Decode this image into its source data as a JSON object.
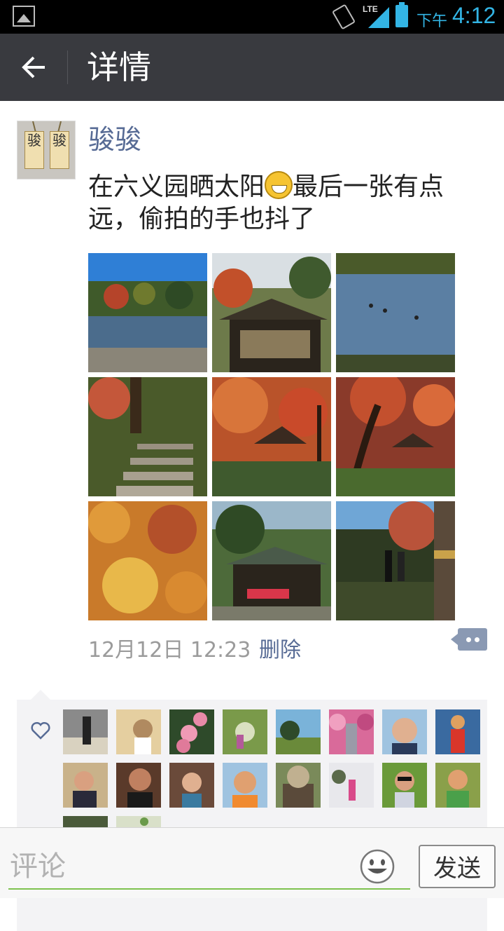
{
  "statusbar": {
    "network": "LTE",
    "ampm": "下午",
    "time": "4:12",
    "icons": [
      "gallery-icon",
      "vibrate-icon",
      "signal-icon",
      "battery-icon"
    ]
  },
  "actionbar": {
    "back_icon": "arrow-left-icon",
    "title": "详情"
  },
  "post": {
    "author": "骏骏",
    "avatar_text": [
      "骏",
      "骏"
    ],
    "text_before_emoji": "在六义园晒太阳",
    "emoji": "grinning-face-emoji",
    "text_after_emoji": "最后一张有点远，偷拍的手也抖了",
    "photos": [
      {
        "name": "pond-blue-sky"
      },
      {
        "name": "teahouse-autumn"
      },
      {
        "name": "pond-ducks"
      },
      {
        "name": "stone-steps"
      },
      {
        "name": "red-maples-pavilion"
      },
      {
        "name": "maple-trunk-pavilion"
      },
      {
        "name": "yellow-maple-leaves"
      },
      {
        "name": "teahouse-red-umbrella"
      },
      {
        "name": "lawn-visitors"
      }
    ],
    "date": "12月12日 12:23",
    "delete_label": "删除",
    "comment_icon": "comment-bubble-icon"
  },
  "likes": {
    "icon": "heart-icon",
    "liker_count": 18
  },
  "bottombar": {
    "placeholder": "评论",
    "emoji_icon": "smiley-icon",
    "send_label": "发送"
  },
  "colors": {
    "actionbar_bg": "#393a3f",
    "name_link": "#576b95",
    "statusbar_accent": "#33b5e5",
    "input_underline": "#7ec24f"
  }
}
